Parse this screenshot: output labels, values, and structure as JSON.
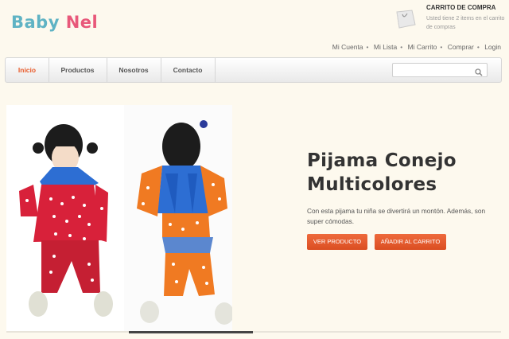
{
  "logo": {
    "part1": "Baby",
    "part2": "Nel"
  },
  "cart": {
    "title": "CARRITO DE COMPRA",
    "text": "Usted tiene 2 items en el carrito de compras"
  },
  "toplinks": [
    "Mi Cuenta",
    "Mi Lista",
    "Mi Carrito",
    "Comprar",
    "Login"
  ],
  "nav": {
    "items": [
      "Inicio",
      "Productos",
      "Nosotros",
      "Contacto"
    ],
    "active": "Inicio",
    "search_placeholder": ""
  },
  "hero": {
    "title_line1": "Pijama Conejo",
    "title_line2": "Multicolores",
    "description": "Con esta pijama tu niña se divertirá un montón. Además, son super cómodas.",
    "btn_view": "VER PRODUCTO",
    "btn_cart": "AÑADIR AL CARRITO"
  },
  "colors": {
    "accent": "#e85a2a",
    "logo_blue": "#5fb3c4",
    "logo_pink": "#e8587a"
  }
}
